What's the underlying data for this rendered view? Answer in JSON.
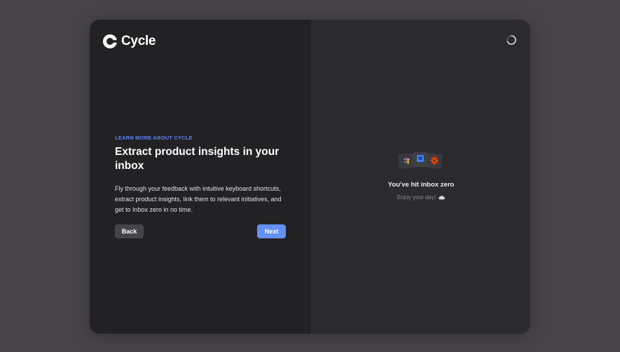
{
  "brand": {
    "name": "Cycle",
    "accent": "#5b82f0",
    "primary_button": "#6490f3"
  },
  "onboarding": {
    "eyebrow": "LEARN MORE ABOUT CYCLE",
    "title": "Extract product insights in your inbox",
    "description": "Fly through your feedback with intuitive keyboard shortcuts, extract product insights, link them to relevant initiatives, and get to Inbox zero in no time.",
    "back_label": "Back",
    "next_label": "Next"
  },
  "preview": {
    "loading_icon": "spinner-icon",
    "integrations": [
      "slack-icon",
      "intercom-icon",
      "zapier-icon"
    ],
    "empty_title": "You've hit inbox zero",
    "empty_subtitle": "Enjoy your day!",
    "empty_icon": "cloud-icon"
  }
}
